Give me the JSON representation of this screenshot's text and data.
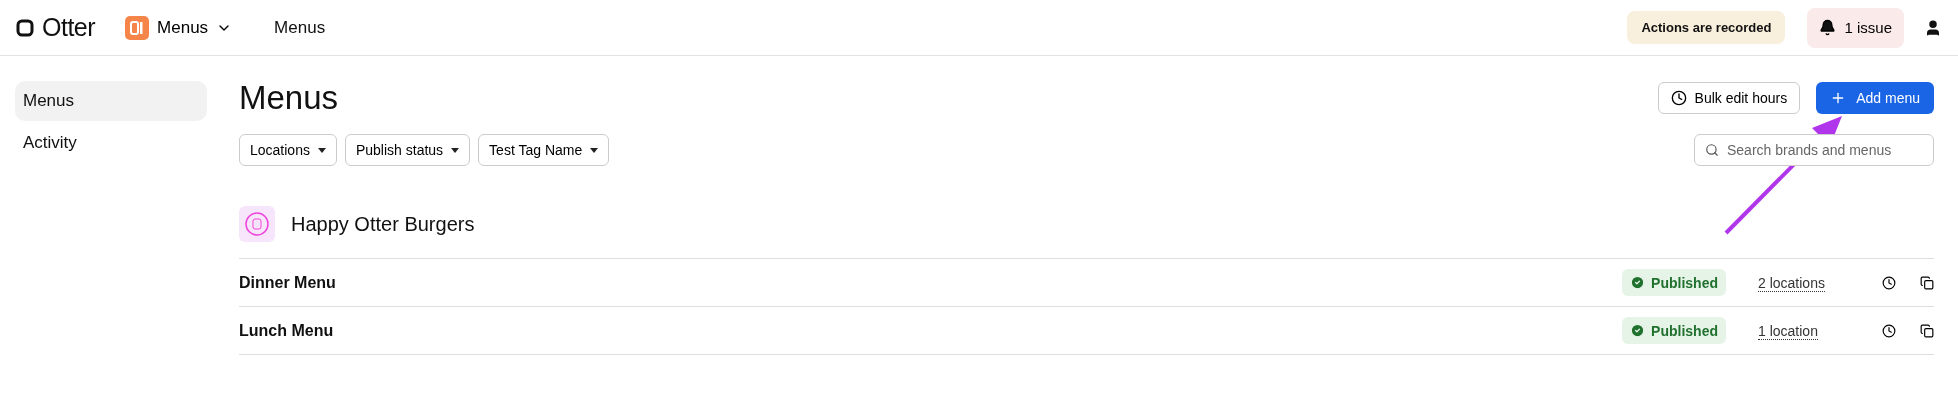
{
  "topbar": {
    "brand": "Otter",
    "app_switcher": "Menus",
    "breadcrumb": "Menus",
    "notice": "Actions are recorded",
    "issues": "1 issue"
  },
  "sidebar": {
    "items": [
      {
        "label": "Menus",
        "selected": true
      },
      {
        "label": "Activity",
        "selected": false
      }
    ]
  },
  "page": {
    "title": "Menus",
    "bulk_button": "Bulk edit hours",
    "add_button": "Add menu",
    "filters": [
      "Locations",
      "Publish status",
      "Test Tag Name"
    ],
    "search": {
      "placeholder": "Search brands and menus"
    }
  },
  "brand": {
    "name": "Happy Otter Burgers"
  },
  "menus": [
    {
      "name": "Dinner Menu",
      "status": "Published",
      "locations": "2 locations"
    },
    {
      "name": "Lunch Menu",
      "status": "Published",
      "locations": "1 location"
    }
  ],
  "annotation": {
    "kind": "arrow"
  }
}
